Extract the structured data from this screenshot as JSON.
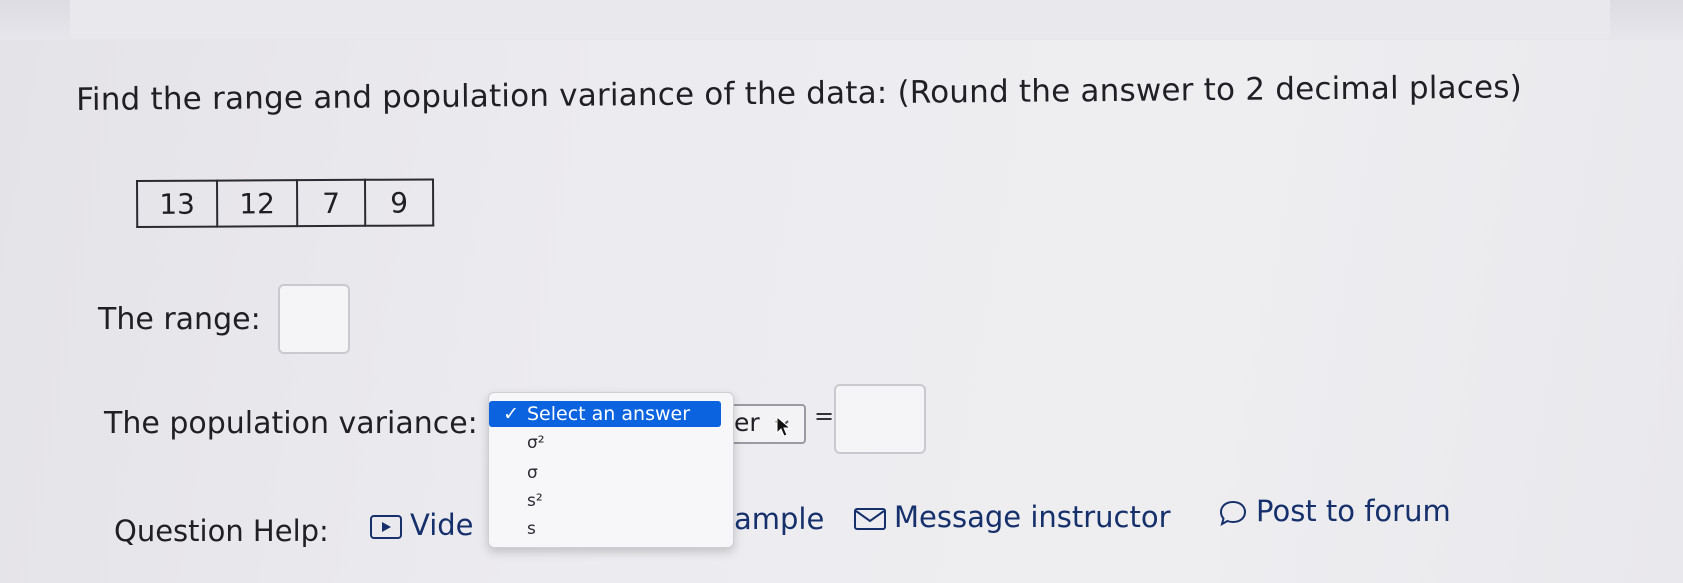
{
  "question": {
    "prompt": "Find the range and population variance of the data: (Round the answer to 2 decimal places)",
    "data_values": [
      "13",
      "12",
      "7",
      "9"
    ]
  },
  "range": {
    "label": "The range:",
    "value": ""
  },
  "variance": {
    "label": "The population variance:",
    "select_visible_text": "er",
    "value": ""
  },
  "dropdown": {
    "selected_label": "Select an answer",
    "options": [
      "σ²",
      "σ",
      "s²",
      "s"
    ]
  },
  "equals_sign": "=",
  "help": {
    "label": "Question Help:",
    "video_visible": "Vide",
    "example_visible": "ample",
    "message_instructor": "Message instructor",
    "post_to_forum": "Post to forum"
  },
  "colors": {
    "selection_highlight": "#0b63e0",
    "link_text": "#16306b",
    "background": "#ecebef"
  },
  "icons": {
    "video": "play-icon",
    "message": "envelope-icon",
    "forum": "speech-bubble-icon",
    "check": "check-icon",
    "chevron": "chevron-down-icon"
  }
}
